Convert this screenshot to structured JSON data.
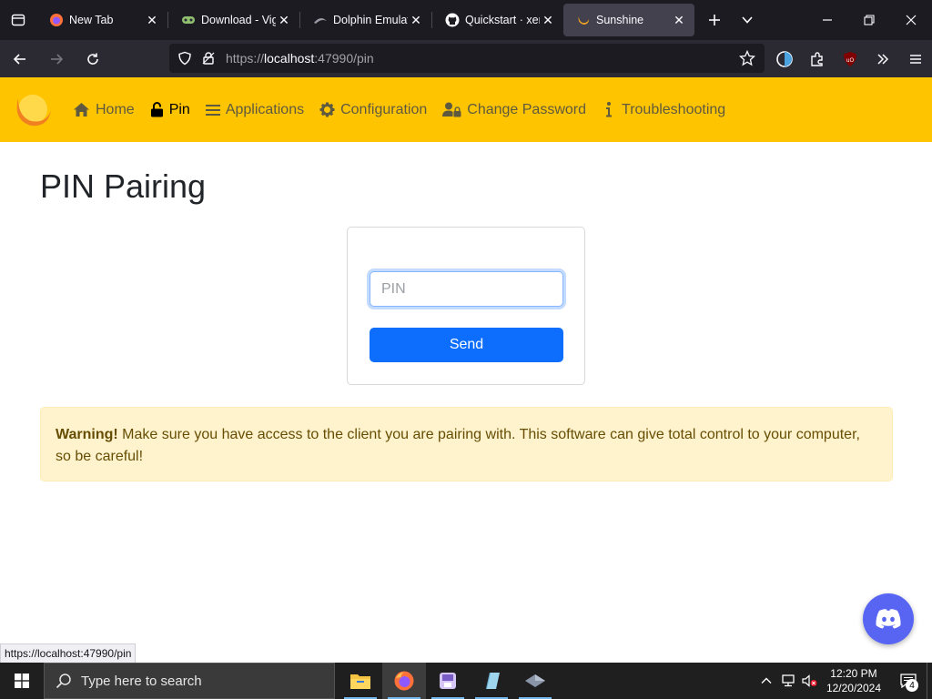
{
  "browser": {
    "tabs": [
      {
        "title": "New Tab",
        "icon": "firefox-icon",
        "active": false
      },
      {
        "title": "Download - Vigem",
        "icon": "vigem-icon",
        "active": false
      },
      {
        "title": "Dolphin Emulator",
        "icon": "dolphin-icon",
        "active": false
      },
      {
        "title": "Quickstart · xenia",
        "icon": "github-icon",
        "active": false
      },
      {
        "title": "Sunshine",
        "icon": "sunshine-icon",
        "active": true
      }
    ],
    "url_prefix": "https://",
    "url_host": "localhost",
    "url_rest": ":47990/pin",
    "status_url": "https://localhost:47990/pin"
  },
  "site": {
    "nav": [
      {
        "label": "Home",
        "icon": "home-icon"
      },
      {
        "label": "Pin",
        "icon": "lock-open-icon",
        "active": true
      },
      {
        "label": "Applications",
        "icon": "list-icon"
      },
      {
        "label": "Configuration",
        "icon": "gear-icon"
      },
      {
        "label": "Change Password",
        "icon": "user-lock-icon"
      },
      {
        "label": "Troubleshooting",
        "icon": "info-icon"
      }
    ],
    "brand_color": "#ffc400"
  },
  "page": {
    "title": "PIN Pairing",
    "pin_placeholder": "PIN",
    "pin_value": "",
    "send_label": "Send",
    "warning_strong": "Warning!",
    "warning_text": " Make sure you have access to the client you are pairing with. This software can give total control to your computer, so be careful!"
  },
  "taskbar": {
    "search_placeholder": "Type here to search",
    "apps": [
      "file-explorer-icon",
      "firefox-icon",
      "app-icon",
      "notepad-icon",
      "app2-icon"
    ],
    "time": "12:20 PM",
    "date": "12/20/2024",
    "notification_count": "4"
  },
  "colors": {
    "accent": "#0d6efd",
    "warning_bg": "#fff3cd",
    "discord": "#5865f2"
  }
}
